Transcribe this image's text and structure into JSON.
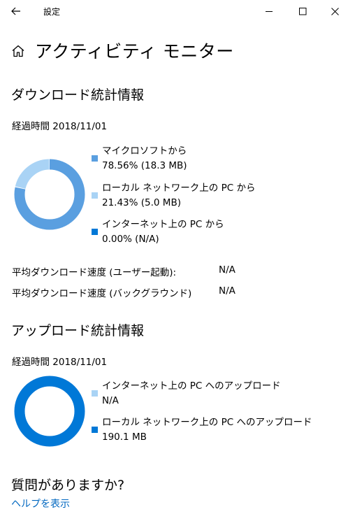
{
  "window": {
    "app_title": "設定"
  },
  "page": {
    "title": "アクティビティ モニター"
  },
  "colors": {
    "microsoft": "#5a9fe0",
    "lan": "#a9d3f5",
    "internet": "#0078d7",
    "link": "#0067c0"
  },
  "icons": {
    "back": "arrow-left-icon",
    "minimize": "minimize-icon",
    "maximize": "maximize-icon",
    "close": "close-icon",
    "home": "home-icon"
  },
  "download": {
    "heading": "ダウンロード統計情報",
    "elapsed": "経過時間 2018/11/01",
    "chart_data": {
      "type": "pie",
      "donut": true,
      "slices": [
        {
          "name": "マイクロソフトから",
          "percent": 78.56,
          "value_mb": 18.3,
          "color": "#5a9fe0"
        },
        {
          "name": "ローカル ネットワーク上の PC から",
          "percent": 21.43,
          "value_mb": 5.0,
          "color": "#a9d3f5"
        },
        {
          "name": "インターネット上の PC から",
          "percent": 0.0,
          "value_mb": null,
          "color": "#0078d7"
        }
      ]
    },
    "legend": [
      {
        "label": "マイクロソフトから",
        "value": "78.56%  (18.3 MB)"
      },
      {
        "label": "ローカル ネットワーク上の PC から",
        "value": "21.43%  (5.0 MB)"
      },
      {
        "label": "インターネット上の PC から",
        "value": "0.00%  (N/A)"
      }
    ],
    "stats": [
      {
        "label": "平均ダウンロード速度 (ユーザー起動):",
        "value": "N/A"
      },
      {
        "label": "平均ダウンロード速度 (バックグラウンド)",
        "value": "N/A"
      }
    ]
  },
  "upload": {
    "heading": "アップロード統計情報",
    "elapsed": "経過時間 2018/11/01",
    "chart_data": {
      "type": "pie",
      "donut": true,
      "slices": [
        {
          "name": "インターネット上の PC へのアップロード",
          "value_mb": null,
          "color": "#a9d3f5"
        },
        {
          "name": "ローカル ネットワーク上の PC へのアップロード",
          "value_mb": 190.1,
          "color": "#0078d7"
        }
      ]
    },
    "legend": [
      {
        "label": "インターネット上の PC へのアップロード",
        "value": "N/A"
      },
      {
        "label": "ローカル ネットワーク上の PC へのアップロード",
        "value": "190.1 MB"
      }
    ]
  },
  "help": {
    "heading": "質問がありますか?",
    "link": "ヘルプを表示"
  }
}
